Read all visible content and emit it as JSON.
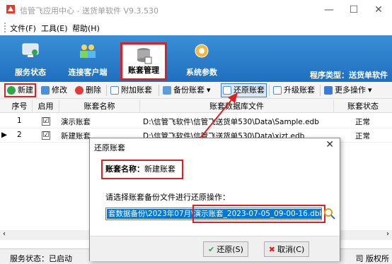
{
  "window": {
    "title": "信管飞应用中心 - 送货单软件 V9.3.530",
    "min": "—",
    "max": "☐",
    "close": "✕"
  },
  "menu": [
    "文件(F)",
    "工具(E)",
    "帮助(H)"
  ],
  "ribbon": {
    "items": [
      "服务状态",
      "连接客户端",
      "账套管理",
      "系统参数"
    ],
    "program_type": "程序类型：送货单软件"
  },
  "toolbar": {
    "new": "新建",
    "edit": "修改",
    "delete": "删除",
    "attach": "附加账套",
    "backup": "备份账套",
    "restore": "还原账套",
    "upgrade": "升级账套",
    "more": "更多操作"
  },
  "table": {
    "headers": [
      "序号",
      "启用",
      "账套名称",
      "账套数据库文件",
      "账套状态"
    ],
    "rows": [
      {
        "no": "1",
        "checked": "☑",
        "name": "演示账套",
        "file": "D:\\信管飞软件\\信管飞送货单530\\Data\\Sample.edb",
        "status": "正常"
      },
      {
        "no": "2",
        "checked": "☑",
        "name": "新建账套",
        "file": "D:\\信管飞软件\\信管飞送货单530\\Data\\xjzt.edb",
        "status": "正常"
      }
    ]
  },
  "status": {
    "left": "服务状态：已启动",
    "right": "司 版权所"
  },
  "dialog": {
    "title": "还原账套",
    "close": "✕",
    "name_label": "账套名称：",
    "name_value": "新建账套",
    "prompt": "请选择账套备份文件进行还原操作：",
    "path": "套数据备份\\2023年07月\\演示账套_2023-07-05_09-00-16.dbk",
    "ok": "还原(S)",
    "cancel": "取消(C)"
  },
  "colors": {
    "accent": "#1f6fbf",
    "highlight": "#e02020"
  }
}
